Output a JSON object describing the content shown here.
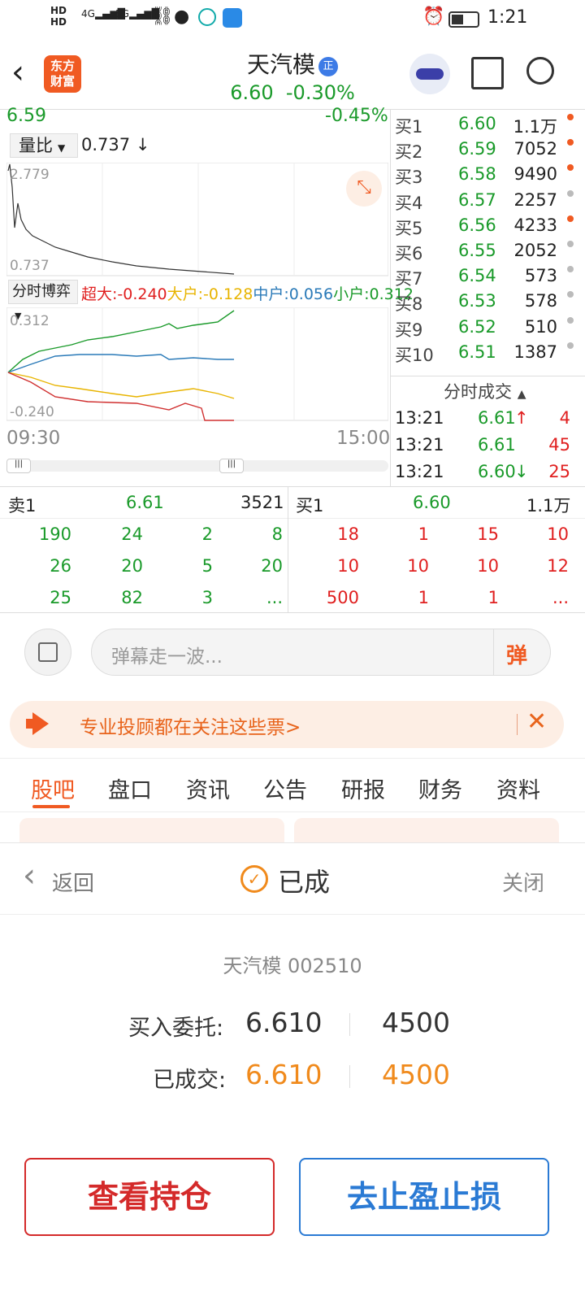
{
  "status_bar": {
    "network_left": "HD",
    "signal_4g": "4G",
    "signal_5g": "5G",
    "time": "1:21"
  },
  "header": {
    "logo_line1": "东方",
    "logo_line2": "财富",
    "stock_name": "天汽模",
    "badge": "正",
    "price": "6.60",
    "change": "-0.30%"
  },
  "chart": {
    "price_label": "6.59",
    "pct_label": "-0.45%",
    "volume_ratio_label": "量比",
    "volume_ratio_value": "0.737",
    "volume_ratio_arrow": "↓",
    "vr_max": "2.779",
    "vr_min": "0.737",
    "flow_selector": "分时博弈",
    "flow_super": "超大:-0.240",
    "flow_big": "大户:-0.128",
    "flow_mid": "中户:0.056",
    "flow_small": "小户:0.312",
    "flow_max": "0.312",
    "flow_min": "-0.240",
    "time_start": "09:30",
    "time_end": "15:00"
  },
  "order_book": [
    {
      "label": "买1",
      "price": "6.60",
      "vol": "1.1万",
      "dot": "#f05a22"
    },
    {
      "label": "买2",
      "price": "6.59",
      "vol": "7052",
      "dot": "#f05a22"
    },
    {
      "label": "买3",
      "price": "6.58",
      "vol": "9490",
      "dot": "#f05a22"
    },
    {
      "label": "买4",
      "price": "6.57",
      "vol": "2257",
      "dot": "#bbbbbb"
    },
    {
      "label": "买5",
      "price": "6.56",
      "vol": "4233",
      "dot": "#f05a22"
    },
    {
      "label": "买6",
      "price": "6.55",
      "vol": "2052",
      "dot": "#bbbbbb"
    },
    {
      "label": "买7",
      "price": "6.54",
      "vol": "573",
      "dot": "#bbbbbb"
    },
    {
      "label": "买8",
      "price": "6.53",
      "vol": "578",
      "dot": "#bbbbbb"
    },
    {
      "label": "买9",
      "price": "6.52",
      "vol": "510",
      "dot": "#bbbbbb"
    },
    {
      "label": "买10",
      "price": "6.51",
      "vol": "1387",
      "dot": "#bbbbbb"
    }
  ],
  "ticks": {
    "title": "分时成交",
    "rows": [
      {
        "time": "13:21",
        "price": "6.61",
        "arrow": "↑",
        "vol": "4"
      },
      {
        "time": "13:21",
        "price": "6.61",
        "arrow": "",
        "vol": "45"
      },
      {
        "time": "13:21",
        "price": "6.60",
        "arrow": "↓",
        "vol": "25"
      }
    ]
  },
  "queue": {
    "sell_label": "卖1",
    "sell_price": "6.61",
    "sell_vol": "3521",
    "buy_label": "买1",
    "buy_price": "6.60",
    "buy_vol": "1.1万",
    "sell_rows": [
      [
        "190",
        "24",
        "2",
        "8"
      ],
      [
        "26",
        "20",
        "5",
        "20"
      ],
      [
        "25",
        "82",
        "3",
        "..."
      ]
    ],
    "buy_rows": [
      [
        "18",
        "1",
        "15",
        "10"
      ],
      [
        "10",
        "10",
        "10",
        "12"
      ],
      [
        "500",
        "1",
        "1",
        "..."
      ]
    ]
  },
  "danmaku": {
    "placeholder": "弹幕走一波...",
    "send": "弹"
  },
  "banner": {
    "text": "专业投顾都在关注这些票>"
  },
  "tabs": [
    "股吧",
    "盘口",
    "资讯",
    "公告",
    "研报",
    "财务",
    "资料"
  ],
  "modal": {
    "back": "返回",
    "status": "已成",
    "close": "关闭",
    "stock_line": "天汽模 002510",
    "entrust_label": "买入委托:",
    "entrust_price": "6.610",
    "entrust_qty": "4500",
    "filled_label": "已成交:",
    "filled_price": "6.610",
    "filled_qty": "4500",
    "btn_positions": "查看持仓",
    "btn_stop": "去止盈止损"
  }
}
